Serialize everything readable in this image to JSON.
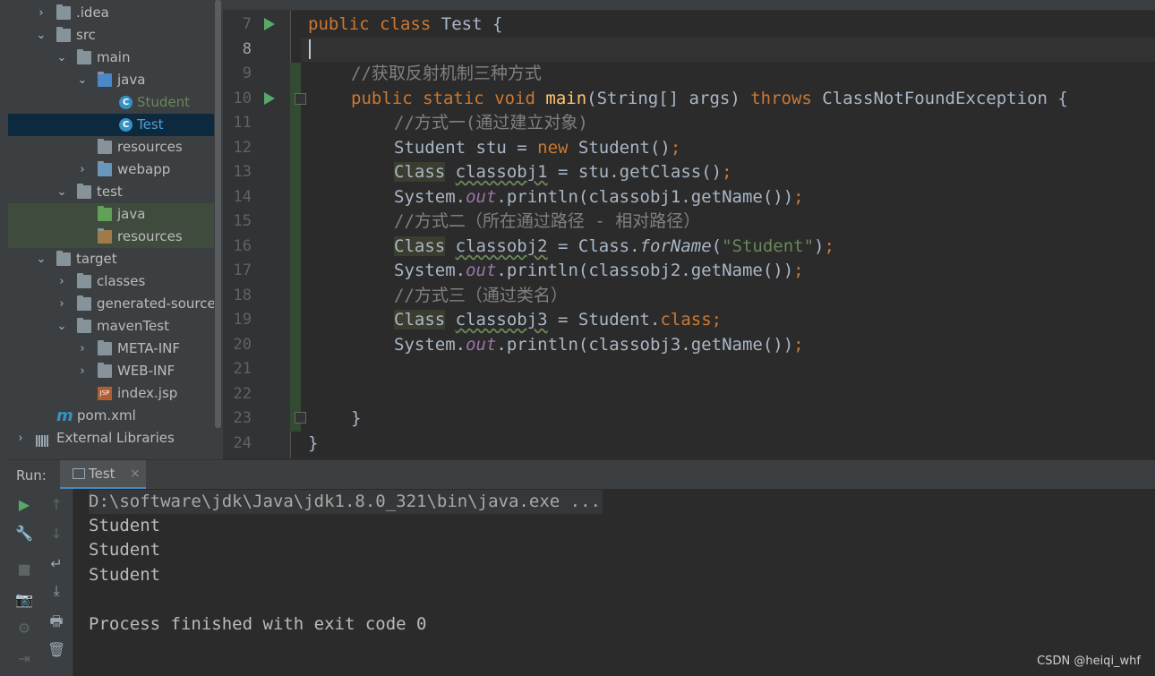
{
  "project_tree": [
    {
      "label": ".idea",
      "arrow": "›",
      "icon": "folder-icon"
    },
    {
      "label": "src",
      "arrow": "⌄",
      "icon": "folder-icon"
    },
    {
      "label": "main",
      "arrow": "⌄",
      "icon": "folder-icon"
    },
    {
      "label": "java",
      "arrow": "⌄",
      "icon": "source-folder-icon"
    },
    {
      "label": "Student",
      "arrow": "",
      "icon": "java-class-icon"
    },
    {
      "label": "Test",
      "arrow": "",
      "icon": "java-class-icon"
    },
    {
      "label": "resources",
      "arrow": "",
      "icon": "resources-folder-icon"
    },
    {
      "label": "webapp",
      "arrow": "›",
      "icon": "web-folder-icon"
    },
    {
      "label": "test",
      "arrow": "⌄",
      "icon": "folder-icon"
    },
    {
      "label": "java",
      "arrow": "",
      "icon": "test-source-folder-icon"
    },
    {
      "label": "resources",
      "arrow": "",
      "icon": "test-resources-folder-icon"
    },
    {
      "label": "target",
      "arrow": "⌄",
      "icon": "folder-icon"
    },
    {
      "label": "classes",
      "arrow": "›",
      "icon": "folder-icon"
    },
    {
      "label": "generated-sources",
      "arrow": "›",
      "icon": "folder-icon"
    },
    {
      "label": "mavenTest",
      "arrow": "⌄",
      "icon": "folder-icon"
    },
    {
      "label": "META-INF",
      "arrow": "›",
      "icon": "folder-icon"
    },
    {
      "label": "WEB-INF",
      "arrow": "›",
      "icon": "folder-icon"
    },
    {
      "label": "index.jsp",
      "arrow": "",
      "icon": "jsp-file-icon"
    },
    {
      "label": "pom.xml",
      "arrow": "",
      "icon": "maven-icon"
    },
    {
      "label": "External Libraries",
      "arrow": "›",
      "icon": "libraries-icon"
    }
  ],
  "icons": {
    "maven_glyph": "m",
    "class_glyph": "C",
    "jsp_glyph": "JSP"
  },
  "editor": {
    "line_numbers": [
      "7",
      "8",
      "9",
      "10",
      "11",
      "12",
      "13",
      "14",
      "15",
      "16",
      "17",
      "18",
      "19",
      "20",
      "21",
      "22",
      "23",
      "24"
    ],
    "current_line": "8"
  },
  "code": {
    "l7": {
      "kw1": "public",
      "kw2": "class",
      "name": "Test {"
    },
    "l9": "//获取反射机制三种方式",
    "l10": {
      "kw1": "public",
      "kw2": "static",
      "kw3": "void",
      "fn": "main",
      "args": "(String[] args) ",
      "kw4": "throws",
      "rest": " ClassNotFoundException {"
    },
    "l11": "//方式一(通过建立对象)",
    "l12": {
      "a": "Student stu = ",
      "kw": "new",
      "b": " Student()",
      "semi": ";"
    },
    "l13": {
      "cls": "Class",
      "var": "classobj1",
      "b": " = stu.getClass()",
      "semi": ";"
    },
    "l14": {
      "a": "System.",
      "fld": "out",
      "b": ".println(classobj1.getName())",
      "semi": ";"
    },
    "l15": "//方式二（所在通过路径 - 相对路径）",
    "l16": {
      "cls": "Class",
      "var": "classobj2",
      "b": " = Class.",
      "it": "forName",
      "c": "(",
      "st": "\"Student\"",
      "d": ")",
      "semi": ";"
    },
    "l17": {
      "a": "System.",
      "fld": "out",
      "b": ".println(classobj2.getName())",
      "semi": ";"
    },
    "l18": "//方式三（通过类名）",
    "l19": {
      "cls": "Class",
      "var": "classobj3",
      "b": " = Student.",
      "kw": "class",
      "semi": ";"
    },
    "l20": {
      "a": "System.",
      "fld": "out",
      "b": ".println(classobj3.getName())",
      "semi": ";"
    },
    "l23": "}",
    "l24": "}"
  },
  "run_panel": {
    "label": "Run:",
    "tab_label": "Test",
    "tab_close": "×",
    "tools_left": [
      "▶",
      "🔧",
      "■",
      "📷",
      "⚙",
      "⇥"
    ],
    "tools_right": [
      "↑",
      "↓",
      "↵",
      "⤓",
      "🖶",
      "🗑"
    ],
    "console": [
      "D:\\software\\jdk\\Java\\jdk1.8.0_321\\bin\\java.exe ...",
      "Student",
      "Student",
      "Student",
      "",
      "Process finished with exit code 0"
    ]
  },
  "watermark": "CSDN @heiqi_whf",
  "colors": {
    "keyword": "#cc7832",
    "comment": "#808080",
    "method": "#ffc66d",
    "string": "#6a8759",
    "field": "#9876aa",
    "text": "#a9b7c6"
  }
}
